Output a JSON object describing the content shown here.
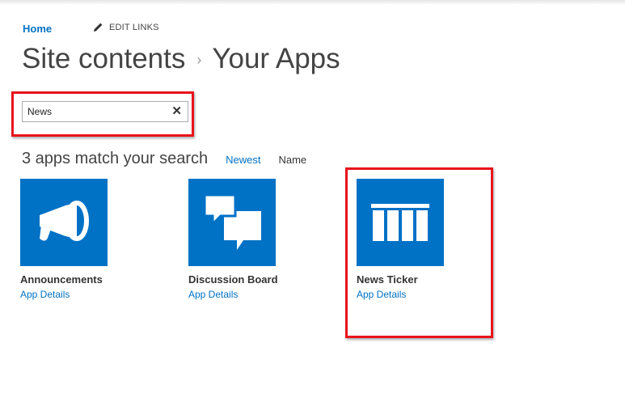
{
  "nav": {
    "home_label": "Home",
    "edit_links_label": "EDIT LINKS",
    "edit_icon": "pencil-icon"
  },
  "title": {
    "parent": "Site contents",
    "separator": "›",
    "current": "Your Apps"
  },
  "search": {
    "value": "News",
    "clear_icon": "close-icon",
    "clear_glyph": "✕"
  },
  "results": {
    "count_text": "3 apps match your search",
    "sort_options": [
      "Newest",
      "Name"
    ],
    "active_sort": "Newest"
  },
  "apps": [
    {
      "name": "Announcements",
      "details_label": "App Details",
      "icon": "megaphone-icon"
    },
    {
      "name": "Discussion Board",
      "details_label": "App Details",
      "icon": "speech-bubbles-icon"
    },
    {
      "name": "News Ticker",
      "details_label": "App Details",
      "icon": "ticker-columns-icon"
    }
  ],
  "colors": {
    "accent": "#0072c6",
    "tile_background": "#0072c6",
    "highlight_box": "#e8141b",
    "text": "#444444"
  }
}
